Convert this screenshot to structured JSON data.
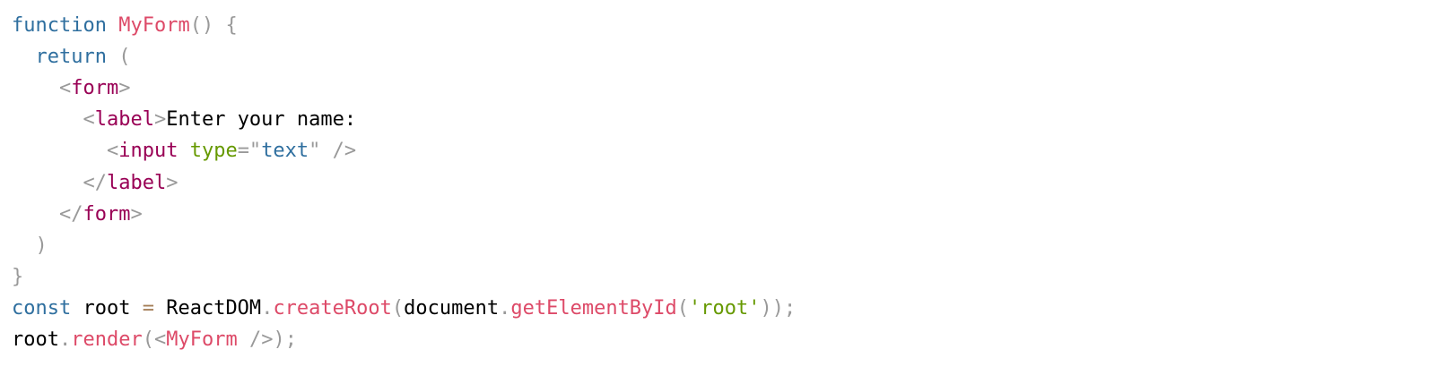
{
  "colors": {
    "background": "#ffffff",
    "keyword": "#2f6f9f",
    "function_name": "#dd4a68",
    "punctuation": "#999999",
    "tag": "#990055",
    "attr_name": "#669900",
    "attr_value": "#2f6f9f",
    "string": "#669900",
    "operator": "#a67f59",
    "plain": "#000000"
  },
  "code": {
    "lines": [
      {
        "tokens": [
          {
            "text": "function",
            "kind": "keyword"
          },
          {
            "text": " ",
            "kind": "plain"
          },
          {
            "text": "MyForm",
            "kind": "function_name"
          },
          {
            "text": "()",
            "kind": "punctuation"
          },
          {
            "text": " ",
            "kind": "plain"
          },
          {
            "text": "{",
            "kind": "punctuation"
          }
        ]
      },
      {
        "tokens": [
          {
            "text": "  ",
            "kind": "plain"
          },
          {
            "text": "return",
            "kind": "keyword"
          },
          {
            "text": " ",
            "kind": "plain"
          },
          {
            "text": "(",
            "kind": "punctuation"
          }
        ]
      },
      {
        "tokens": [
          {
            "text": "    ",
            "kind": "plain"
          },
          {
            "text": "<",
            "kind": "punctuation"
          },
          {
            "text": "form",
            "kind": "tag"
          },
          {
            "text": ">",
            "kind": "punctuation"
          }
        ]
      },
      {
        "tokens": [
          {
            "text": "      ",
            "kind": "plain"
          },
          {
            "text": "<",
            "kind": "punctuation"
          },
          {
            "text": "label",
            "kind": "tag"
          },
          {
            "text": ">",
            "kind": "punctuation"
          },
          {
            "text": "Enter your name:",
            "kind": "plain"
          }
        ]
      },
      {
        "tokens": [
          {
            "text": "        ",
            "kind": "plain"
          },
          {
            "text": "<",
            "kind": "punctuation"
          },
          {
            "text": "input",
            "kind": "tag"
          },
          {
            "text": " ",
            "kind": "plain"
          },
          {
            "text": "type",
            "kind": "attr_name"
          },
          {
            "text": "=\"",
            "kind": "punctuation"
          },
          {
            "text": "text",
            "kind": "attr_value"
          },
          {
            "text": "\"",
            "kind": "punctuation"
          },
          {
            "text": " ",
            "kind": "plain"
          },
          {
            "text": "/>",
            "kind": "punctuation"
          }
        ]
      },
      {
        "tokens": [
          {
            "text": "      ",
            "kind": "plain"
          },
          {
            "text": "</",
            "kind": "punctuation"
          },
          {
            "text": "label",
            "kind": "tag"
          },
          {
            "text": ">",
            "kind": "punctuation"
          }
        ]
      },
      {
        "tokens": [
          {
            "text": "    ",
            "kind": "plain"
          },
          {
            "text": "</",
            "kind": "punctuation"
          },
          {
            "text": "form",
            "kind": "tag"
          },
          {
            "text": ">",
            "kind": "punctuation"
          }
        ]
      },
      {
        "tokens": [
          {
            "text": "  ",
            "kind": "plain"
          },
          {
            "text": ")",
            "kind": "punctuation"
          }
        ]
      },
      {
        "tokens": [
          {
            "text": "}",
            "kind": "punctuation"
          }
        ]
      },
      {
        "tokens": [
          {
            "text": "const",
            "kind": "keyword"
          },
          {
            "text": " root ",
            "kind": "plain"
          },
          {
            "text": "=",
            "kind": "operator"
          },
          {
            "text": " ReactDOM",
            "kind": "plain"
          },
          {
            "text": ".",
            "kind": "punctuation"
          },
          {
            "text": "createRoot",
            "kind": "function_name"
          },
          {
            "text": "(",
            "kind": "punctuation"
          },
          {
            "text": "document",
            "kind": "plain"
          },
          {
            "text": ".",
            "kind": "punctuation"
          },
          {
            "text": "getElementById",
            "kind": "function_name"
          },
          {
            "text": "(",
            "kind": "punctuation"
          },
          {
            "text": "'root'",
            "kind": "string"
          },
          {
            "text": "));",
            "kind": "punctuation"
          }
        ]
      },
      {
        "tokens": [
          {
            "text": "root",
            "kind": "plain"
          },
          {
            "text": ".",
            "kind": "punctuation"
          },
          {
            "text": "render",
            "kind": "function_name"
          },
          {
            "text": "(<",
            "kind": "punctuation"
          },
          {
            "text": "MyForm",
            "kind": "function_name"
          },
          {
            "text": " ",
            "kind": "plain"
          },
          {
            "text": "/>);",
            "kind": "punctuation"
          }
        ]
      }
    ]
  }
}
